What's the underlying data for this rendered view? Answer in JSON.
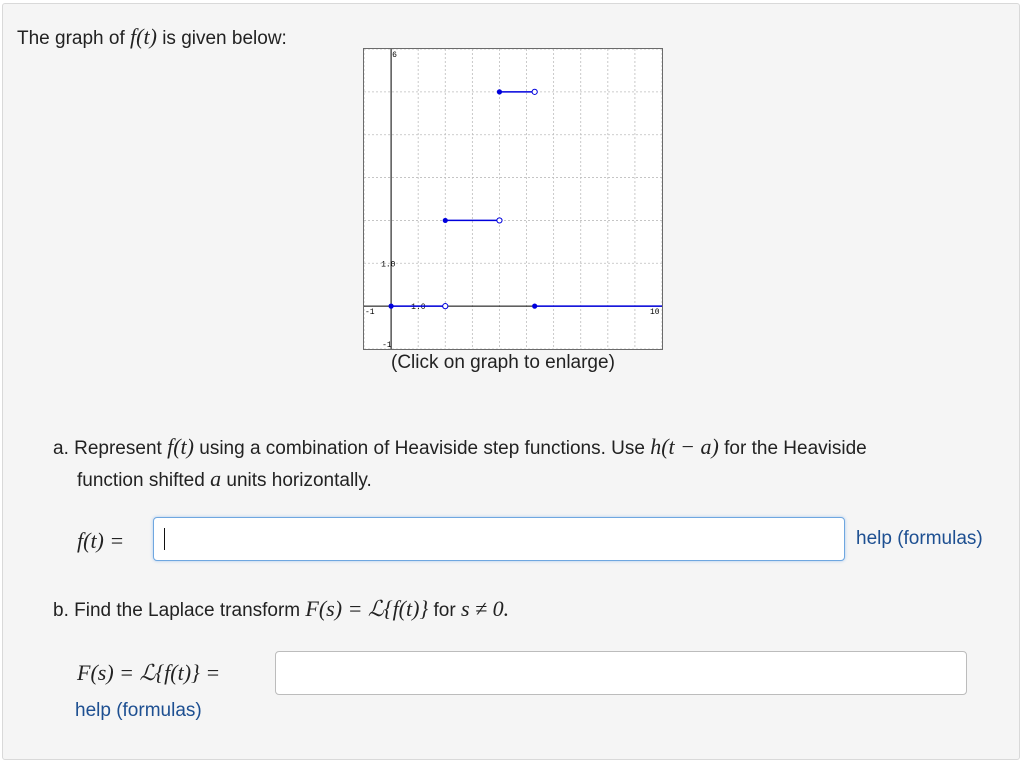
{
  "intro": {
    "prefix": "The graph of",
    "func": "f(t)",
    "suffix": "is given below:"
  },
  "graph": {
    "caption": "(Click on graph to enlarge)",
    "colors": {
      "segment": "#0000dd",
      "axis": "#000000",
      "grid": "#bdbdbd"
    },
    "tick_labels": {
      "y_top": "6",
      "y_one": "1.0",
      "y_neg": "-1",
      "x_neg": "-1",
      "x_one": "1.0",
      "x_max": "10"
    }
  },
  "chart_data": {
    "type": "line",
    "xlim": [
      -1,
      10
    ],
    "ylim": [
      -1,
      6
    ],
    "grid": true,
    "segments": [
      {
        "x": [
          0,
          2
        ],
        "y": [
          0,
          0
        ],
        "start": "closed",
        "end": "open"
      },
      {
        "x": [
          2,
          4
        ],
        "y": [
          2,
          2
        ],
        "start": "closed",
        "end": "open"
      },
      {
        "x": [
          4,
          5.3
        ],
        "y": [
          5,
          5
        ],
        "start": "closed",
        "end": "open"
      },
      {
        "x": [
          5.3,
          10
        ],
        "y": [
          0,
          0
        ],
        "start": "closed",
        "end": "none"
      }
    ]
  },
  "part_a": {
    "text1": "a. Represent",
    "func": "f(t)",
    "text2": "using a combination of Heaviside step functions. Use",
    "heaviside": "h(t − a)",
    "text3": "for the Heaviside",
    "text4": "function shifted",
    "var_a": "a",
    "text5": "units horizontally."
  },
  "input_f": {
    "label": "f(t) =",
    "value": ""
  },
  "help_f": "help (formulas)",
  "part_b": {
    "text1": "b. Find the Laplace transform",
    "expr": "F(s) = ℒ{f(t)}",
    "text2": "for",
    "cond": "s ≠ 0."
  },
  "input_F": {
    "label": "F(s) = ℒ{f(t)} =",
    "value": ""
  },
  "help_F": "help (formulas)"
}
